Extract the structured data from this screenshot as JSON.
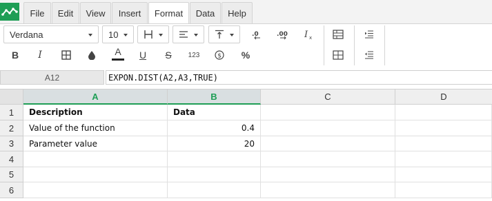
{
  "menu": {
    "items": [
      "File",
      "Edit",
      "View",
      "Insert",
      "Format",
      "Data",
      "Help"
    ],
    "active": "Format"
  },
  "toolbar": {
    "font_name": "Verdana",
    "font_size": "10",
    "bold_label": "B",
    "italic_label": "I",
    "text_color_label": "A",
    "underline_label": "U",
    "strike_label": "S",
    "number_format_label": "123",
    "percent_label": "%",
    "decrease_decimals_label": ".0",
    "increase_decimals_label": ".00",
    "clear_format_label": "I"
  },
  "formula_bar": {
    "cell_ref": "A12",
    "formula": "EXPON.DIST(A2,A3,TRUE)"
  },
  "sheet": {
    "columns": [
      "A",
      "B",
      "C",
      "D"
    ],
    "selected_columns": [
      "A",
      "B"
    ],
    "rows": [
      "1",
      "2",
      "3",
      "4",
      "5",
      "6"
    ],
    "cells": {
      "A1": "Description",
      "B1": "Data",
      "A2": "Value of the function",
      "B2": "0.4",
      "A3": "Parameter value",
      "B3": "20"
    }
  },
  "colors": {
    "accent": "#1e9e55",
    "header_bg": "#efefef",
    "selected_header_bg": "#d9dfe1"
  }
}
